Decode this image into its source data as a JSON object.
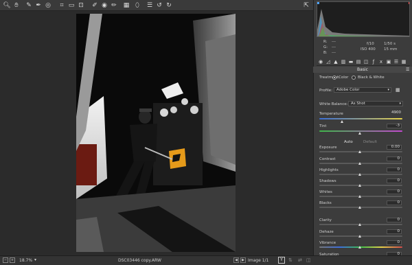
{
  "toolbar": {
    "tools": [
      "zoom-icon",
      "hand-icon",
      "white-balance-icon",
      "color-sampler-icon",
      "targeted-adjustment-icon",
      "crop-icon",
      "straighten-icon",
      "transform-icon",
      "spot-removal-icon",
      "red-eye-icon",
      "adjustment-brush-icon",
      "graduated-filter-icon",
      "radial-filter-icon",
      "preferences-icon",
      "rotate-left-icon",
      "rotate-right-icon"
    ],
    "fullscreen_icon": "fullscreen-icon"
  },
  "readout": {
    "r_label": "R:",
    "g_label": "G:",
    "b_label": "B:",
    "r_val": "---",
    "g_val": "---",
    "b_val": "---",
    "aperture": "f/10",
    "shutter": "1/50 s",
    "iso": "ISO 400",
    "focal": "15 mm"
  },
  "panel": {
    "section_title": "Basic",
    "treatment_label": "Treatment:",
    "treatment_color": "Color",
    "treatment_bw": "Black & White",
    "profile_label": "Profile:",
    "profile_value": "Adobe Color",
    "wb_label": "White Balance:",
    "wb_value": "As Shot",
    "temperature_label": "Temperature",
    "temperature_value": "4900",
    "tint_label": "Tint",
    "tint_value": "-3",
    "auto_label": "Auto",
    "default_label": "Default",
    "sliders": [
      {
        "label": "Exposure",
        "value": "0.00"
      },
      {
        "label": "Contrast",
        "value": "0"
      },
      {
        "label": "Highlights",
        "value": "0"
      },
      {
        "label": "Shadows",
        "value": "0"
      },
      {
        "label": "Whites",
        "value": "0"
      },
      {
        "label": "Blacks",
        "value": "0"
      },
      {
        "label": "Clarity",
        "value": "0"
      },
      {
        "label": "Dehaze",
        "value": "0"
      },
      {
        "label": "Vibrance",
        "value": "0"
      },
      {
        "label": "Saturation",
        "value": "0"
      }
    ]
  },
  "bottom": {
    "zoom": "18.7%",
    "filename": "DSC03446 copy.ARW",
    "image_count": "Image 1/1"
  }
}
